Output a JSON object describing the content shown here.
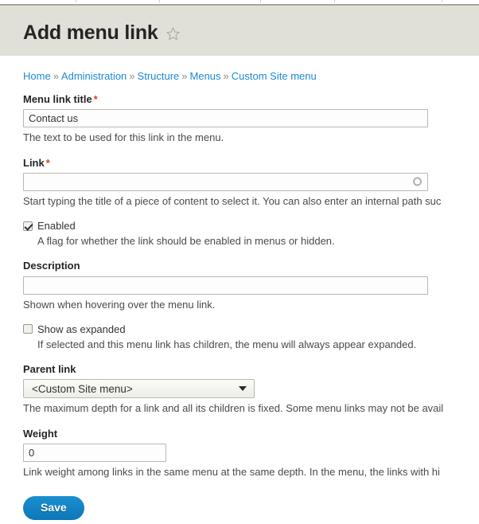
{
  "toolbar": {
    "divider_positions": [
      95,
      200,
      327,
      420,
      555
    ]
  },
  "header": {
    "title": "Add menu link",
    "star_icon": "star-outline-icon"
  },
  "breadcrumb": {
    "separator": "»",
    "items": [
      {
        "label": "Home"
      },
      {
        "label": "Administration"
      },
      {
        "label": "Structure"
      },
      {
        "label": "Menus"
      },
      {
        "label": "Custom Site menu"
      }
    ]
  },
  "form": {
    "menu_link_title": {
      "label": "Menu link title",
      "required_marker": "*",
      "value": "Contact us",
      "description": "The text to be used for this link in the menu."
    },
    "link": {
      "label": "Link",
      "required_marker": "*",
      "value": "",
      "placeholder": "",
      "throbber_icon": "autocomplete-throbber-icon",
      "description": "Start typing the title of a piece of content to select it. You can also enter an internal path suc"
    },
    "enabled": {
      "label": "Enabled",
      "checked": true,
      "description": "A flag for whether the link should be enabled in menus or hidden."
    },
    "description_field": {
      "label": "Description",
      "value": "",
      "description": "Shown when hovering over the menu link."
    },
    "show_as_expanded": {
      "label": "Show as expanded",
      "checked": false,
      "description": "If selected and this menu link has children, the menu will always appear expanded."
    },
    "parent_link": {
      "label": "Parent link",
      "selected": "<Custom Site menu>",
      "options": [
        "<Custom Site menu>"
      ],
      "description": "The maximum depth for a link and all its children is fixed. Some menu links may not be avail"
    },
    "weight": {
      "label": "Weight",
      "value": "0",
      "description": "Link weight among links in the same menu at the same depth. In the menu, the links with hi"
    },
    "save_button": "Save"
  },
  "colors": {
    "header_band": "#e0e0d8",
    "link_blue": "#1e88d3",
    "required_red": "#e23d25",
    "button_blue": "#1283c4"
  }
}
